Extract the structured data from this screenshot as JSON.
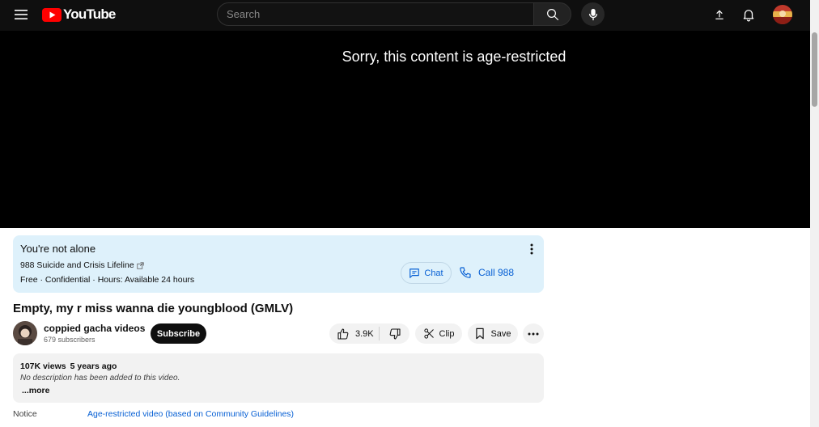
{
  "header": {
    "logo_text": "YouTube",
    "search_placeholder": "Search"
  },
  "player": {
    "message": "Sorry, this content is age-restricted"
  },
  "crisis_panel": {
    "title": "You're not alone",
    "org": "988 Suicide and Crisis Lifeline",
    "details": "Free · Confidential · Hours: Available 24 hours",
    "chat_label": "Chat",
    "call_label": "Call 988"
  },
  "video": {
    "title": "Empty, my r miss wanna die youngblood (GMLV)",
    "channel_name": "coppied gacha videos",
    "subscribers": "679 subscribers",
    "subscribe_label": "Subscribe",
    "likes": "3.9K",
    "clip_label": "Clip",
    "save_label": "Save"
  },
  "description": {
    "views": "107K views",
    "age": "5 years ago",
    "text": "No description has been added to this video.",
    "more_label": "...more"
  },
  "notice": {
    "label": "Notice",
    "link": "Age-restricted video (based on Community Guidelines)"
  },
  "colors": {
    "accent_link": "#065fd4",
    "crisis_bg": "#def1fb",
    "brand_red": "#ff0000"
  }
}
